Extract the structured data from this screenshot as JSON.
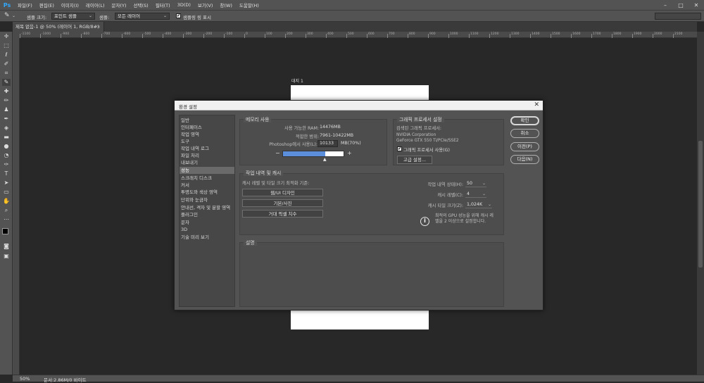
{
  "menubar": {
    "logo": "Ps",
    "items": [
      "파일(F)",
      "편집(E)",
      "이미지(I)",
      "레이어(L)",
      "문자(Y)",
      "선택(S)",
      "필터(T)",
      "3D(D)",
      "보기(V)",
      "창(W)",
      "도움말(H)"
    ],
    "minimize": "–",
    "restore": "□",
    "close": "✕"
  },
  "options": {
    "tool_icon": "eyedropper-icon",
    "sample_size_label": "샘플 크기:",
    "sample_size_value": "포인트 샘플",
    "sample_label": "샘플:",
    "sample_value": "모든 레이어",
    "show_ring_label": "샘플링 링 표시",
    "show_ring_checked": "✔"
  },
  "document": {
    "tab_title": "제목 없음-1 @ 50% (레이어 1, RGB/8#)",
    "tab_close": "×",
    "artboard_label": "대지 1",
    "ruler_ticks": [
      "-1100",
      "-1000",
      "-900",
      "-800",
      "-700",
      "-600",
      "-500",
      "-400",
      "-300",
      "-200",
      "-100",
      "0",
      "100",
      "200",
      "300",
      "400",
      "500",
      "600",
      "700",
      "800",
      "900",
      "1000",
      "1100",
      "1200",
      "1300",
      "1400",
      "1500",
      "1600",
      "1700",
      "1800",
      "1900",
      "2000",
      "2100"
    ]
  },
  "status": {
    "zoom": "50%",
    "doc": "문서:2.86M/0 바이트"
  },
  "dialog": {
    "title": "환경 설정",
    "close": "✕",
    "nav": [
      "일반",
      "인터페이스",
      "작업 영역",
      "도구",
      "작업 내역 로그",
      "파일 처리",
      "내보내기",
      "성능",
      "스크래치 디스크",
      "커서",
      "투명도와 색상 영역",
      "단위와 눈금자",
      "안내선, 격자 및 분할 영역",
      "플러그인",
      "문자",
      "3D",
      "기술 미리 보기"
    ],
    "selected_nav": "성능",
    "memory": {
      "label": "메모리 사용",
      "available_label": "사용 가능한 RAM:",
      "available_value": "14476MB",
      "ideal_label": "적합한 범위:",
      "ideal_value": "7961-10422MB",
      "ps_label": "Photoshop에서 사용(L):",
      "ps_value": "10133",
      "ps_unit": "MB(70%)",
      "slider_fraction": 0.7,
      "minus": "−",
      "plus": "+"
    },
    "gpu": {
      "label": "그래픽 프로세서 설정",
      "detected_label": "검색된 그래픽 프로세서:",
      "vendor": "NVIDIA Corporation",
      "model": "GeForce GTX 550 Ti/PCIe/SSE2",
      "use_label": "그래픽 프로세서 사용(G)",
      "use_checked": "✔",
      "advanced_button": "고급 설정..."
    },
    "history": {
      "label": "작업 내역 및 캐시",
      "optimize_label": "캐시 레벨 및 타일 크기 최적화 기준:",
      "buttons": [
        "웹/UI 디자인",
        "기본/사진",
        "거대 픽셀 치수"
      ],
      "states_label": "작업 내역 상태(H):",
      "states_value": "50",
      "levels_label": "캐시 레벨(C):",
      "levels_value": "4",
      "tile_label": "캐시 타일 크기(Z):",
      "tile_value": "1,024K",
      "info_icon": "info-icon",
      "info_text_1": "최적의 GPU 성능을 위해 캐시 레",
      "info_text_2": "벨을 2 이상으로 설정합니다."
    },
    "description": {
      "label": "설명"
    },
    "buttons": {
      "ok": "확인",
      "cancel": "취소",
      "prev": "이전(P)",
      "next": "다음(N)"
    }
  }
}
